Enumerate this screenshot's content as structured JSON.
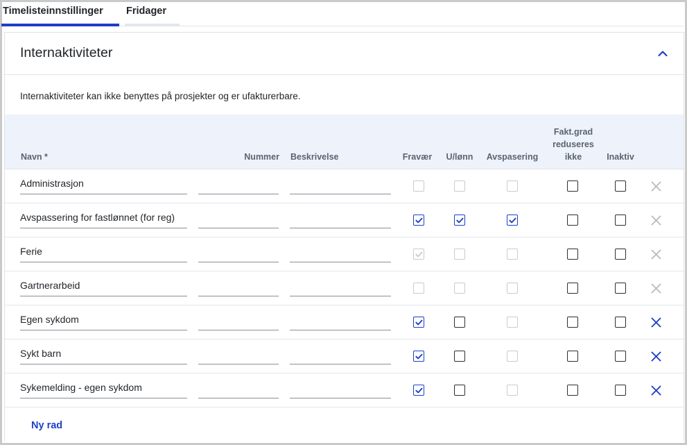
{
  "colors": {
    "accent": "#1d3fc7",
    "tab_inactive_underline": "#e3e6ef",
    "header_bg": "#eef2fb"
  },
  "tabs": [
    {
      "label": "Timelisteinnstillinger",
      "active": true
    },
    {
      "label": "Fridager",
      "active": false
    }
  ],
  "section": {
    "title": "Internaktiviteter",
    "collapse_icon": "chevron-up-icon",
    "description": "Internaktiviteter kan ikke benyttes på prosjekter og er ufakturerbare."
  },
  "table": {
    "headers": {
      "name": "Navn *",
      "number": "Nummer",
      "description": "Beskrivelse",
      "absence": "Fravær",
      "unpaid": "U/lønn",
      "timeoff": "Avspasering",
      "billing_line1": "Fakt.grad",
      "billing_line2": "reduseres",
      "billing_line3": "ikke",
      "inactive": "Inaktiv"
    },
    "rows": [
      {
        "name": "Administrasjon",
        "number": "",
        "description": "",
        "absence": "off-disabled",
        "unpaid": "off-disabled",
        "timeoff": "off-disabled",
        "billing": "off",
        "inactive": "off",
        "delete_enabled": false
      },
      {
        "name": "Avspassering for fastlønnet (for reg)",
        "number": "",
        "description": "",
        "absence": "on",
        "unpaid": "on",
        "timeoff": "on",
        "billing": "off",
        "inactive": "off",
        "delete_enabled": false
      },
      {
        "name": "Ferie",
        "number": "",
        "description": "",
        "absence": "on-disabled",
        "unpaid": "off-disabled",
        "timeoff": "off-disabled",
        "billing": "off",
        "inactive": "off",
        "delete_enabled": false
      },
      {
        "name": "Gartnerarbeid",
        "number": "",
        "description": "",
        "absence": "off-disabled",
        "unpaid": "off-disabled",
        "timeoff": "off-disabled",
        "billing": "off",
        "inactive": "off",
        "delete_enabled": false
      },
      {
        "name": "Egen sykdom",
        "number": "",
        "description": "",
        "absence": "on",
        "unpaid": "off",
        "timeoff": "off-disabled",
        "billing": "off",
        "inactive": "off",
        "delete_enabled": true
      },
      {
        "name": "Sykt barn",
        "number": "",
        "description": "",
        "absence": "on",
        "unpaid": "off",
        "timeoff": "off-disabled",
        "billing": "off",
        "inactive": "off",
        "delete_enabled": true
      },
      {
        "name": "Sykemelding - egen sykdom",
        "number": "",
        "description": "",
        "absence": "on",
        "unpaid": "off",
        "timeoff": "off-disabled",
        "billing": "off",
        "inactive": "off",
        "delete_enabled": true
      }
    ],
    "new_row_label": "Ny rad"
  }
}
